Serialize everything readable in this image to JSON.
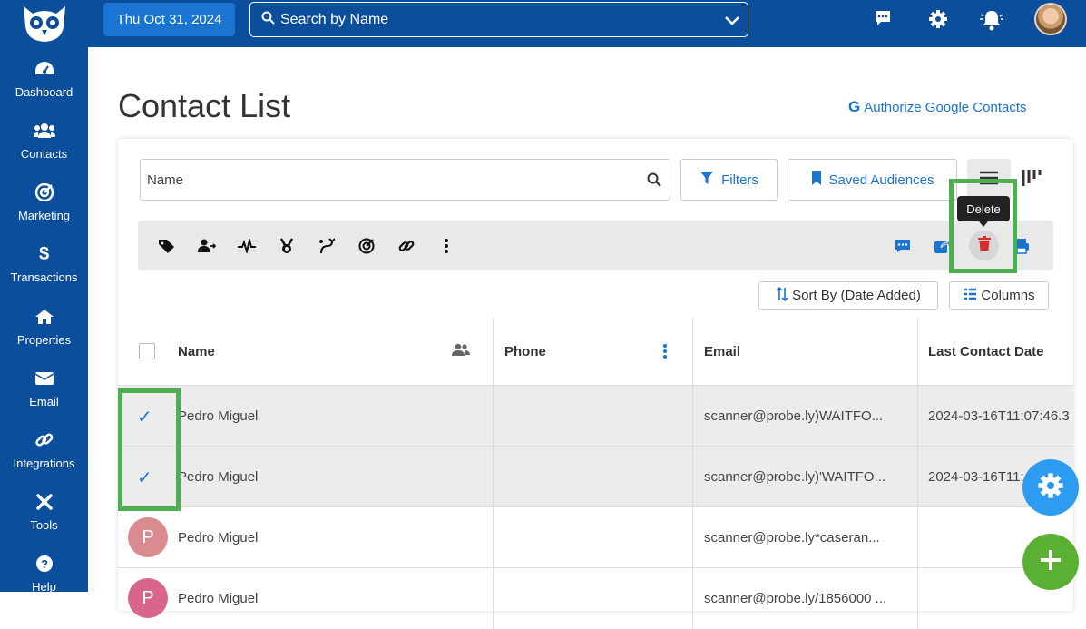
{
  "header": {
    "date": "Thu Oct 31, 2024",
    "search_placeholder": "Search by Name"
  },
  "sidebar": {
    "items": [
      {
        "label": "Dashboard",
        "icon": "dashboard-gauge-icon"
      },
      {
        "label": "Contacts",
        "icon": "users-icon"
      },
      {
        "label": "Marketing",
        "icon": "target-icon"
      },
      {
        "label": "Transactions",
        "icon": "dollar-icon"
      },
      {
        "label": "Properties",
        "icon": "home-icon"
      },
      {
        "label": "Email",
        "icon": "envelope-icon"
      },
      {
        "label": "Integrations",
        "icon": "link-icon"
      },
      {
        "label": "Tools",
        "icon": "tools-icon"
      },
      {
        "label": "Help",
        "icon": "question-icon"
      }
    ]
  },
  "page": {
    "title": "Contact List",
    "google_link": "Authorize Google Contacts",
    "search_placeholder": "Name",
    "filters_label": "Filters",
    "saved_audiences_label": "Saved Audiences",
    "tooltip": "Delete",
    "sort_label": "Sort By (Date Added)",
    "columns_label": "Columns"
  },
  "table": {
    "headers": [
      "Name",
      "Phone",
      "Email",
      "Last Contact Date"
    ],
    "rows": [
      {
        "initial": "",
        "name": "Pedro Miguel",
        "phone": "",
        "email": "scanner@probe.ly)WAITFO...",
        "last_contact": "2024-03-16T11:07:46.3",
        "selected": true
      },
      {
        "initial": "",
        "name": "Pedro Miguel",
        "phone": "",
        "email": "scanner@probe.ly)'WAITFO...",
        "last_contact": "2024-03-16T11:",
        "selected": true
      },
      {
        "initial": "P",
        "name": "Pedro Miguel",
        "phone": "",
        "email": "scanner@probe.ly*caseran...",
        "last_contact": "",
        "selected": false
      },
      {
        "initial": "P",
        "name": "Pedro Miguel",
        "phone": "",
        "email": "scanner@probe.ly/1856000 ...",
        "last_contact": "",
        "selected": false
      }
    ]
  },
  "colors": {
    "brand": "#0b4f9c",
    "accent": "#1a74d2",
    "highlight": "#4caf50",
    "delete": "#d32f2f"
  }
}
